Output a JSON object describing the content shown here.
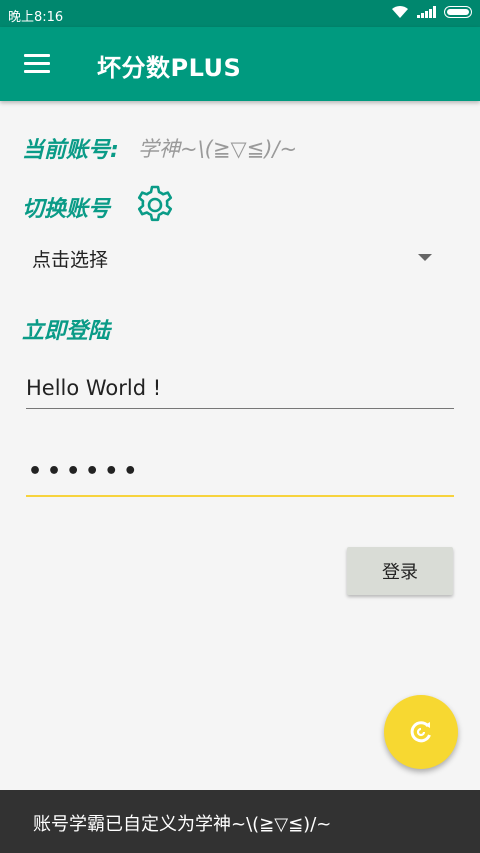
{
  "status_bar": {
    "time": "晚上8:16"
  },
  "app_bar": {
    "title": "坏分数PLUS"
  },
  "account": {
    "current_label": "当前账号:",
    "current_value": "学神~\\(≧▽≦)/~",
    "switch_label": "切换账号",
    "select_value": "点击选择"
  },
  "login": {
    "title": "立即登陆",
    "username_value": "Hello World !",
    "password_value": "••••••",
    "button_label": "登录"
  },
  "snackbar": {
    "message": "账号学霸已自定义为学神~\\(≧▽≦)/~"
  },
  "colors": {
    "primary": "#009a7f",
    "accent": "#f7d831",
    "heading": "#0a9b87"
  },
  "icons": {
    "menu": "menu-icon",
    "settings": "gear-icon",
    "fab": "refresh-icon"
  }
}
